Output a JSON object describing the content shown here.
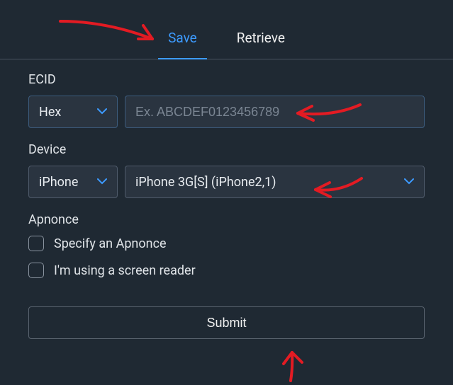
{
  "tabs": {
    "save": "Save",
    "retrieve": "Retrieve"
  },
  "ecid": {
    "label": "ECID",
    "format": "Hex",
    "placeholder": "Ex. ABCDEF0123456789",
    "value": ""
  },
  "device": {
    "label": "Device",
    "type": "iPhone",
    "model": "iPhone 3G[S] (iPhone2,1)"
  },
  "apnonce": {
    "label": "Apnonce",
    "specify": "Specify an Apnonce",
    "screenreader": "I'm using a screen reader"
  },
  "submit": "Submit",
  "colors": {
    "accent": "#3d9bff",
    "bg": "#1f2933"
  }
}
